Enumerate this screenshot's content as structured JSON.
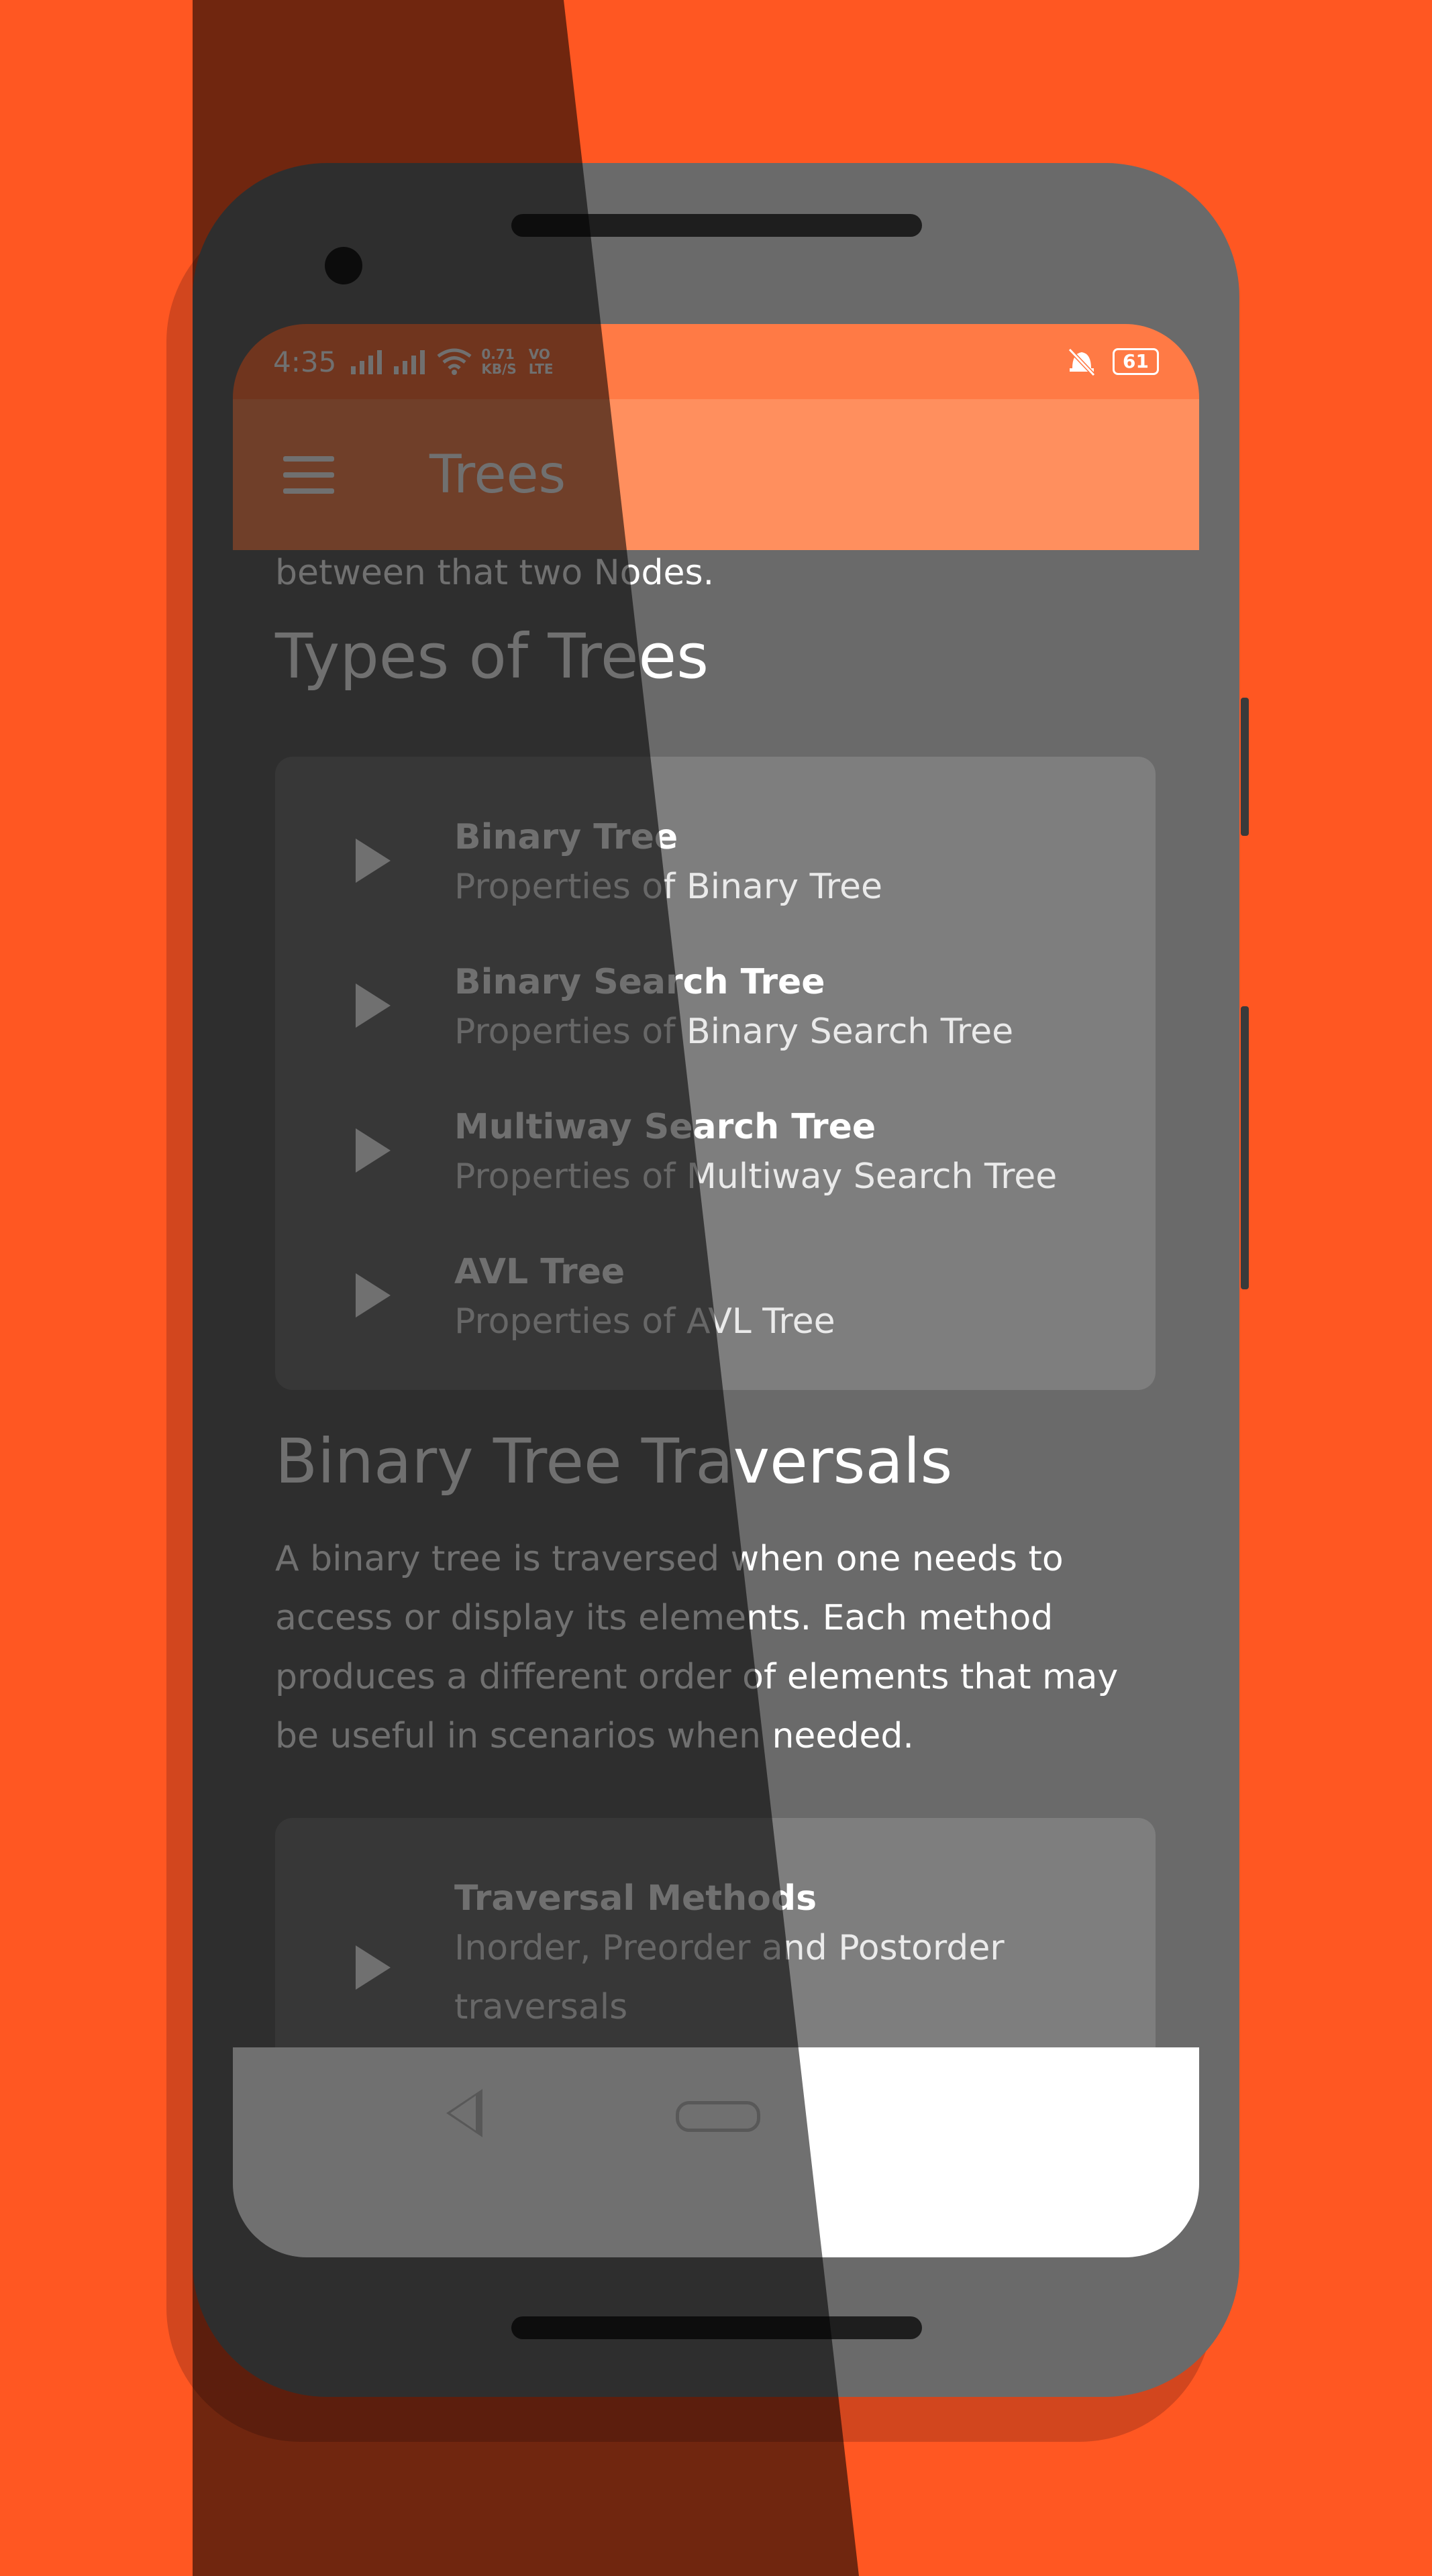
{
  "colors": {
    "background": "#FF5722",
    "status_bar": "#FF7A45",
    "app_bar": "#FF8F5E",
    "content_bg": "#6a6a6a",
    "card_bg": "#7e7e7e"
  },
  "status_bar": {
    "time": "4:35",
    "net_speed": "0.71",
    "net_unit": "KB/S",
    "volte_top": "VO",
    "volte_bottom": "LTE",
    "battery": "61",
    "icons": [
      "signal-icon",
      "signal-icon",
      "wifi-icon",
      "vibrate-off-icon",
      "battery-icon"
    ]
  },
  "app_bar": {
    "menu_icon": "hamburger-menu-icon",
    "title": "Trees"
  },
  "content": {
    "intro_tail": "between that two Nodes.",
    "types_heading": "Types of Trees",
    "types": [
      {
        "title": "Binary Tree",
        "subtitle": "Properties of Binary Tree",
        "icon": "play-icon"
      },
      {
        "title": "Binary Search Tree",
        "subtitle": "Properties of Binary Search Tree",
        "icon": "play-icon"
      },
      {
        "title": "Multiway Search Tree",
        "subtitle": "Properties of Multiway Search Tree",
        "icon": "play-icon"
      },
      {
        "title": "AVL Tree",
        "subtitle": "Properties of AVL Tree",
        "icon": "play-icon"
      }
    ],
    "traversals_heading": "Binary Tree Traversals",
    "traversals_text": "A binary tree is traversed when one needs to access or display its elements. Each method produces a different order of elements that may be useful in scenarios when needed.",
    "traversal_item": {
      "title": "Traversal Methods",
      "subtitle": "Inorder, Preorder and Postorder traversals",
      "icon": "play-icon"
    }
  },
  "nav_bar": {
    "back_icon": "back-triangle-icon",
    "home_icon": "home-pill-icon"
  }
}
